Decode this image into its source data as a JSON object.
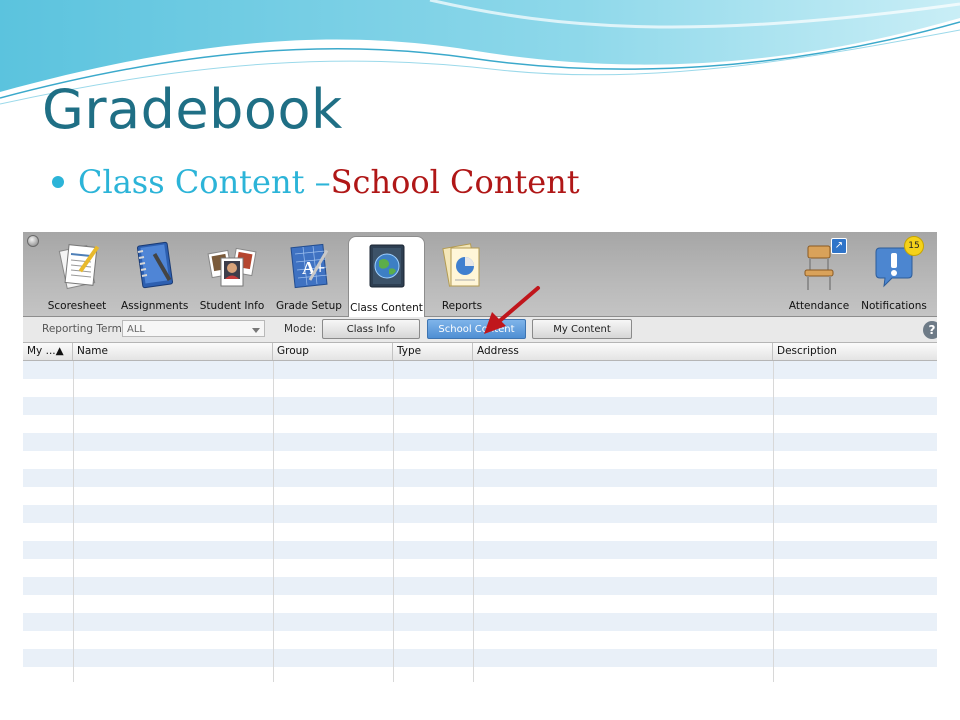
{
  "slide": {
    "title": "Gradebook",
    "bullet": {
      "part1": "Class Content – ",
      "part2": "School Content"
    }
  },
  "toolbar": {
    "items": [
      {
        "label": "Scoresheet",
        "icon": "scoresheet-icon"
      },
      {
        "label": "Assignments",
        "icon": "assignments-notebook-icon"
      },
      {
        "label": "Student Info",
        "icon": "student-photos-icon"
      },
      {
        "label": "Grade Setup",
        "icon": "grade-setup-icon"
      },
      {
        "label": "Class Content",
        "icon": "globe-book-icon",
        "active": true
      },
      {
        "label": "Reports",
        "icon": "reports-chart-icon"
      },
      {
        "label": "Attendance",
        "icon": "chair-icon"
      },
      {
        "label": "Notifications",
        "icon": "exclamation-bubble-icon",
        "badge": "15"
      }
    ]
  },
  "modebar": {
    "reporting_term_label": "Reporting Term:",
    "reporting_term_value": "ALL",
    "mode_label": "Mode:",
    "buttons": [
      "Class Info",
      "School Content",
      "My Content"
    ],
    "selected": "School Content",
    "help": "?"
  },
  "table": {
    "columns": [
      "My ...▲",
      "Name",
      "Group",
      "Type",
      "Address",
      "Description"
    ],
    "rows": []
  },
  "colors": {
    "title": "#1f6f85",
    "bullet_blue": "#2cb4d8",
    "bullet_red": "#b01717",
    "selected_button": "#4f8fd3",
    "row_alt": "#e9f0f8",
    "arrow": "#c0161c"
  }
}
